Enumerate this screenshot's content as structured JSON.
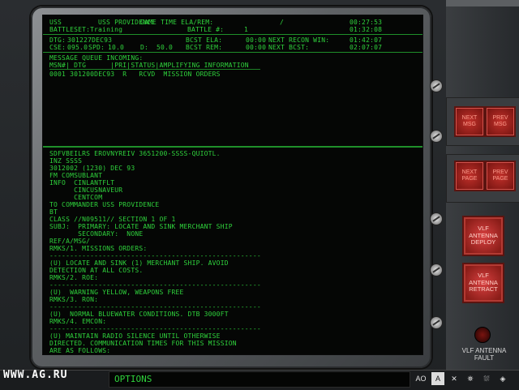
{
  "header": {
    "row1_left": "USS",
    "row1_ship": "USS PROVIDENCE",
    "row1_game_time_label": "GAME TIME ELA/REM:",
    "row1_slash": "/",
    "row1_time": "00:27:53",
    "row2_battleset_label": "BATTLESET:",
    "row2_battleset_value": "Training",
    "row2_battle_label": "BATTLE #:",
    "row2_battle_value": "1",
    "row2_time": "01:32:08",
    "dtg_label": "DTG:",
    "dtg_value": "301227DEC93",
    "bcst_ela_label": "BCST ELA:",
    "bcst_ela_value": "00:00",
    "next_recon_label": "NEXT RECON WIN:",
    "next_recon_value": "01:42:07",
    "cse_label": "CSE:",
    "cse_value": "095.0",
    "spd_label": "SPD:",
    "spd_value": "10.0",
    "depth_label": "D:",
    "depth_value": "50.0",
    "bcst_rem_label": "BCST REM:",
    "bcst_rem_value": "00:00",
    "next_bcst_label": "NEXT BCST:",
    "next_bcst_value": "02:07:07"
  },
  "queue": {
    "title": "MESSAGE QUEUE INCOMING:",
    "columns": "MSN#| DTG      |PRI|STATUS|AMPLIFYING INFORMATION",
    "rows": [
      "0001 301200DEC93  R   RCVD  MISSION ORDERS"
    ]
  },
  "message": {
    "lines": [
      "SDFVBEILRS EROVNYREIV 3651200-SSSS-QUIOTL.",
      "INZ SSSS",
      "3012002 (1230) DEC 93",
      "FM COMSUBLANT",
      "INFO  CINLANTFLT",
      "      CINCUSNAVEUR",
      "      CENTCOM",
      "TO COMMANDER USS PROVIDENCE",
      "BT",
      "CLASS //N09511// SECTION 1 OF 1",
      "SUBJ:  PRIMARY: LOCATE AND SINK MERCHANT SHIP",
      "       SECONDARY:  NONE",
      "REF/A/MSG/",
      "",
      "RMKS/1. MISSIONS ORDERS:",
      "----------------------------------------------------",
      "(U) LOCATE AND SINK (1) MERCHANT SHIP. AVOID",
      "DETECTION AT ALL COSTS.",
      "RMKS/2. ROE:",
      "----------------------------------------------------",
      "(U)  WARNING YELLOW, WEAPONS FREE",
      "",
      "RMKS/3. RON:",
      "----------------------------------------------------",
      "(U)  NORMAL BLUEWATER CONDITIONS. DTB 3000FT",
      "",
      "RMKS/4. EMCON:",
      "----------------------------------------------------",
      "(U) MAINTAIN RADIO SILENCE UNTIL OTHERWISE",
      "DIRECTED. COMMUNICATION TIMES FOR THIS MISSION",
      "ARE AS FOLLOWS:"
    ]
  },
  "buttons": {
    "next_msg": "NEXT MSG",
    "prev_msg": "PREV MSG",
    "next_page": "NEXT PAGE",
    "prev_page": "PREV PAGE",
    "vlf_deploy": "VLF ANTENNA DEPLOY",
    "vlf_retract": "VLF ANTENNA RETRACT"
  },
  "status": {
    "vlf_fault": "VLF ANTENNA FAULT"
  },
  "bottom": {
    "watermark": "WWW.AG.RU",
    "options": "OPTIONS",
    "tool_ao": "AO",
    "tool_a": "A",
    "tool_2": "✕",
    "tool_3": "⛯",
    "tool_4": "⛆",
    "tool_5": "◈"
  },
  "colors": {
    "phosphor_green": "#2fd23c",
    "button_red": "#c0302a"
  }
}
